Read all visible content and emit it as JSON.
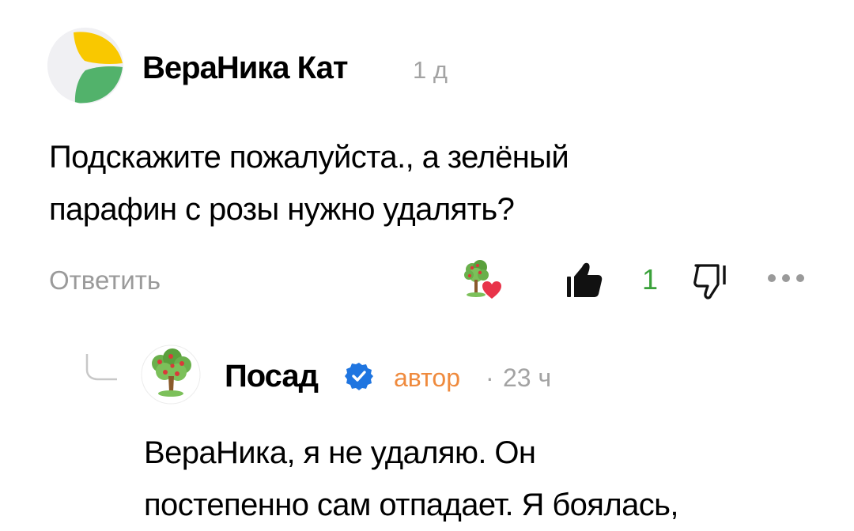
{
  "comment": {
    "author": "ВераНика Кат",
    "time": "1 д",
    "text_lines": [
      "Подскажите пожалуйста., а зелёный",
      "парафин с розы нужно удалять?"
    ],
    "avatar_icon": "yandex-zen-avatar-icon",
    "actions": {
      "reply_label": "Ответить",
      "reaction_icon": "tree-heart-reaction-icon",
      "like_icon": "thumbs-up-icon",
      "like_count": "1",
      "dislike_icon": "thumbs-down-icon",
      "more_icon": "more-dots-icon"
    }
  },
  "reply": {
    "author": "Посад",
    "verified_icon": "verified-check-icon",
    "badge": "автор",
    "separator": "·",
    "time": "23 ч",
    "avatar_icon": "apple-tree-avatar-icon",
    "text_lines": [
      "ВераНика, я не удаляю. Он",
      "постепенно сам отпадает. Я боялась,"
    ]
  },
  "colors": {
    "accent_green": "#3aa13a",
    "author_badge": "#ef8a3d",
    "verified_blue": "#1f75e0",
    "muted_text": "#9a9a9a",
    "zen_yellow": "#f9c800",
    "zen_green": "#52b26b"
  }
}
